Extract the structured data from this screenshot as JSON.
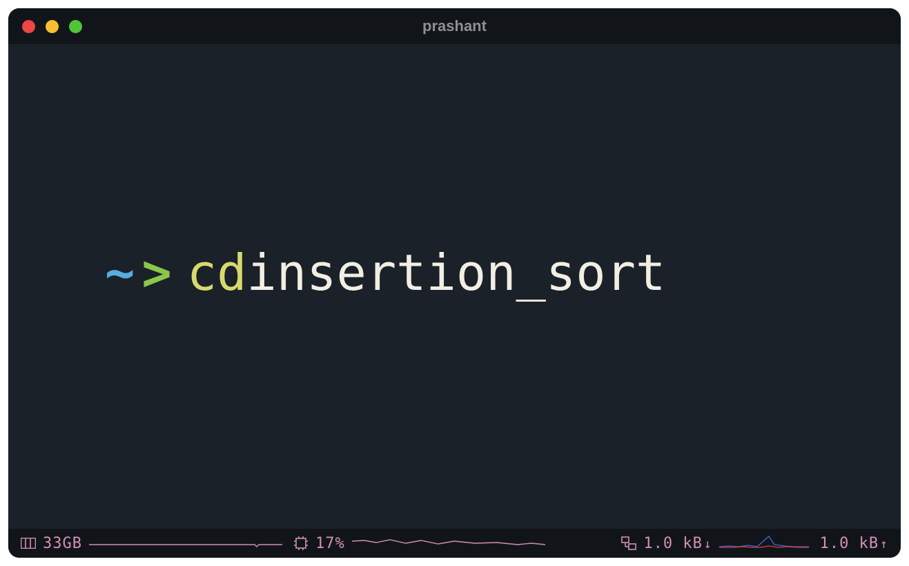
{
  "window": {
    "title": "prashant"
  },
  "prompt": {
    "tilde": "~",
    "arrow": ">",
    "command": "cd",
    "argument": " insertion_sort"
  },
  "statusbar": {
    "disk": {
      "value": "33GB"
    },
    "cpu": {
      "value": "17%"
    },
    "net_down": {
      "value": "1.0 kB",
      "arrow": "↓"
    },
    "net_up": {
      "value": "1.0 kB",
      "arrow": "↑"
    }
  },
  "colors": {
    "bg": "#1b2128",
    "titlebar_bg": "#11151a",
    "tilde": "#54aee0",
    "arrow": "#8bc84a",
    "command": "#d7d96e",
    "text": "#f1eee2",
    "status": "#d390b5"
  }
}
